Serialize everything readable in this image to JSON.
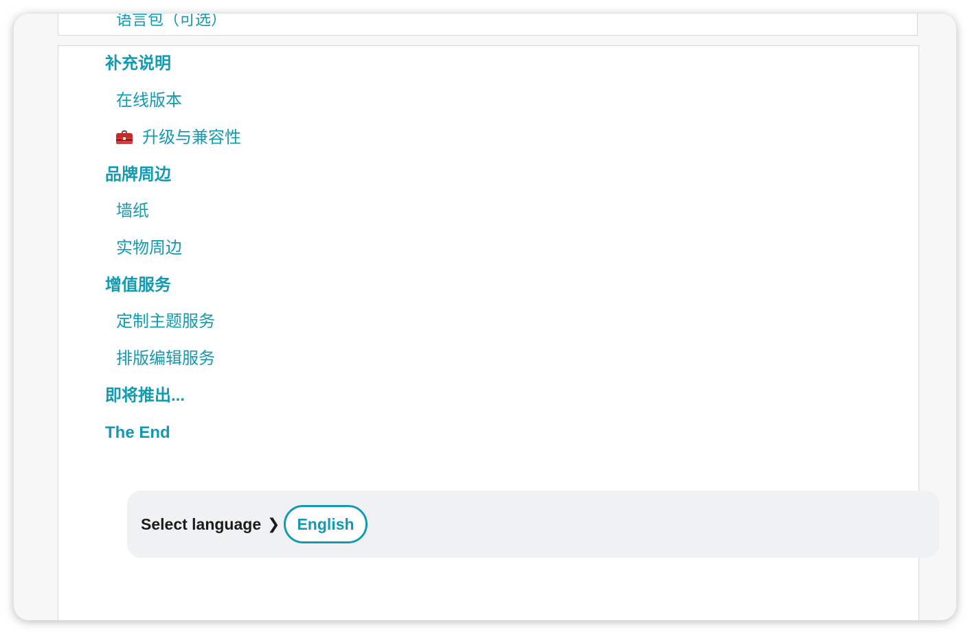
{
  "nav": {
    "cut_off_top_link": "语言包（可选）",
    "sections": [
      {
        "label": "补充说明",
        "items": [
          {
            "label": "在线版本",
            "icon": ""
          },
          {
            "label": "升级与兼容性",
            "icon": "toolbox-icon"
          }
        ]
      },
      {
        "label": "品牌周边",
        "items": [
          {
            "label": "墙纸"
          },
          {
            "label": "实物周边"
          }
        ]
      },
      {
        "label": "增值服务",
        "items": [
          {
            "label": "定制主题服务"
          },
          {
            "label": "排版编辑服务"
          }
        ]
      },
      {
        "label": "即将推出...",
        "items": []
      },
      {
        "label": "The End",
        "items": []
      }
    ]
  },
  "language": {
    "label": "Select language",
    "chevron": "❯",
    "current": "English"
  },
  "colors": {
    "link": "#129ab3",
    "text": "#1b1b1b",
    "lang_bar_bg": "#f0f1f2",
    "border": "#d6d6d6"
  }
}
